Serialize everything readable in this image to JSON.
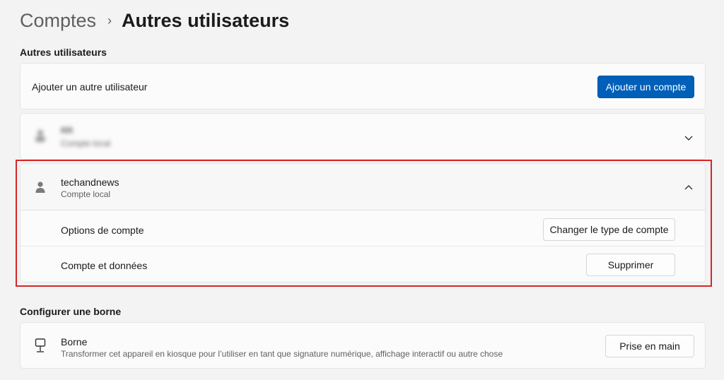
{
  "breadcrumb": {
    "parent": "Comptes",
    "separator": "›",
    "current": "Autres utilisateurs"
  },
  "other_users": {
    "section_title": "Autres utilisateurs",
    "add_row_label": "Ajouter un autre utilisateur",
    "add_button": "Ajouter un compte",
    "blurred_user": {
      "name": "RR",
      "sub": "Compte local"
    },
    "user": {
      "name": "techandnews",
      "sub": "Compte local",
      "options_label": "Options de compte",
      "options_button": "Changer le type de compte",
      "data_label": "Compte et données",
      "data_button": "Supprimer"
    }
  },
  "kiosk": {
    "section_title": "Configurer une borne",
    "title": "Borne",
    "description": "Transformer cet appareil en kiosque pour l’utiliser en tant que signature numérique, affichage interactif ou autre chose",
    "button": "Prise en main"
  },
  "colors": {
    "accent": "#005fb8",
    "highlight": "#d62626",
    "background": "#f3f3f3",
    "card": "#fbfbfb"
  },
  "icons": {
    "user": "person-icon",
    "kiosk": "kiosk-icon",
    "expand": "chevron-down-icon",
    "collapse": "chevron-up-icon"
  }
}
